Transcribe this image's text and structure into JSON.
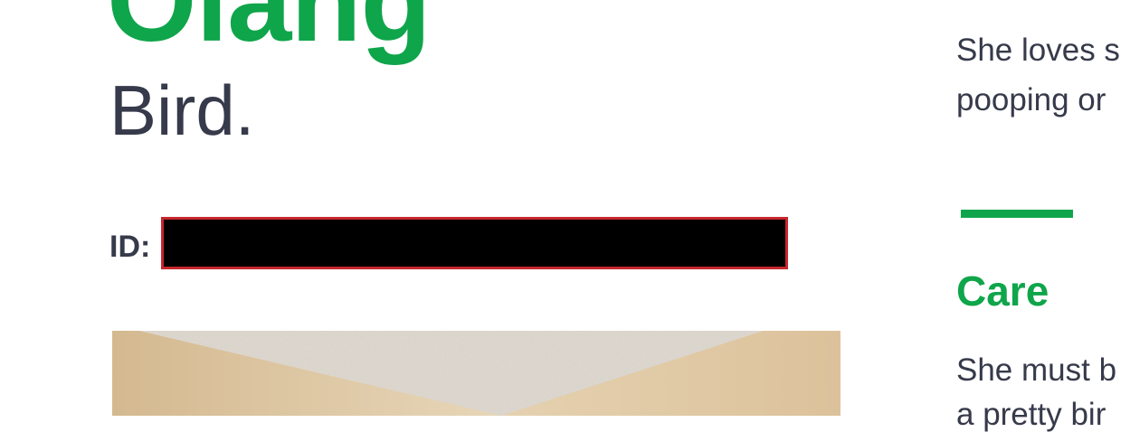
{
  "profile": {
    "name": "Olang",
    "species": "Bird.",
    "id_label": "ID:",
    "id_value_redacted": true
  },
  "sidebar": {
    "about_lines": [
      "She loves s",
      "pooping or"
    ],
    "care_heading": "Care",
    "care_lines": [
      "She must b",
      "a pretty bir"
    ]
  },
  "colors": {
    "brand_green": "#0fa54a",
    "text_dark": "#363a4a",
    "redaction_border": "#c6262e"
  }
}
